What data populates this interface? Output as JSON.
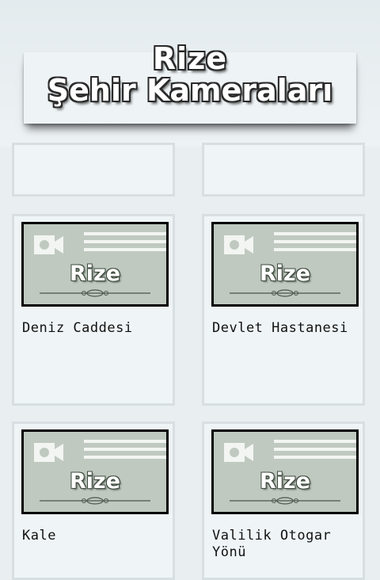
{
  "header": {
    "title_line1": "Rize",
    "title_line2": "Şehir Kameraları"
  },
  "thumbnail": {
    "label": "Rize",
    "icon": "video-camera-icon"
  },
  "cameras": [
    {
      "name": ""
    },
    {
      "name": ""
    },
    {
      "name": "Deniz Caddesi"
    },
    {
      "name": "Devlet Hastanesi"
    },
    {
      "name": "Kale"
    },
    {
      "name": "Valilik Otogar Yönü"
    }
  ],
  "colors": {
    "background": "#e9eef0",
    "card": "#eff5f7",
    "thumbnail": "#c0c9c0"
  }
}
